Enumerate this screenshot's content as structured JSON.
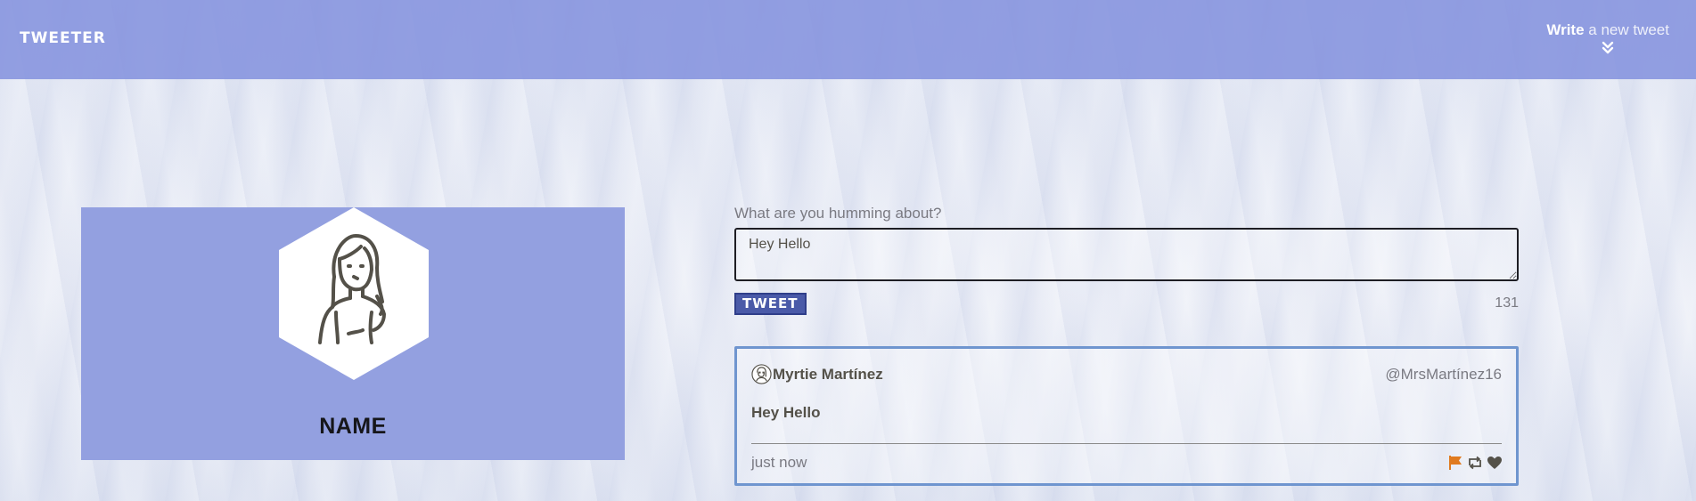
{
  "header": {
    "brand": "TWEETER",
    "compose_toggle": {
      "strong": "Write",
      "rest": " a new tweet",
      "icon": "double-chevron-down-icon"
    }
  },
  "profile": {
    "avatar_icon": "user-avatar-icon",
    "name": "NAME"
  },
  "compose": {
    "label": "What are you humming about?",
    "value": "Hey Hello",
    "button_label": "TWEET",
    "char_counter": "131"
  },
  "tweets": [
    {
      "avatar_icon": "user-avatar-icon",
      "user_name": "Myrtie Martínez",
      "handle": "@MrsMartínez16",
      "text": "Hey Hello",
      "time": "just now",
      "actions": [
        "flag-icon",
        "retweet-icon",
        "heart-icon"
      ]
    }
  ],
  "colors": {
    "header_bg": "#8593de",
    "profile_bg": "#93a0e0",
    "tweet_border": "#6f95cf",
    "button_bg": "#4a5aa8",
    "flag": "#e07a1f",
    "icon_dark": "#545149"
  }
}
